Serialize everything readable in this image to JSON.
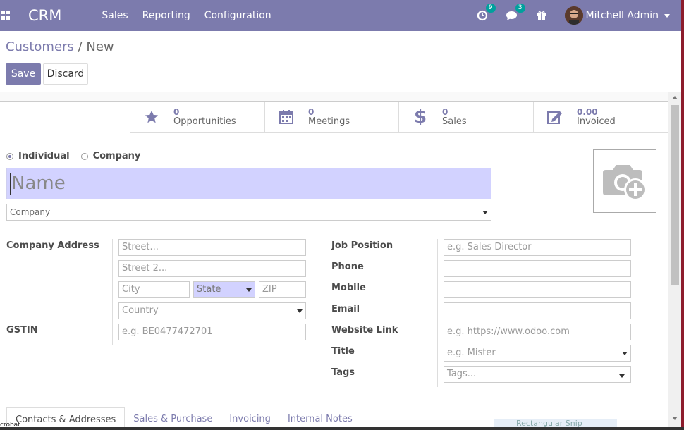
{
  "navbar": {
    "brand": "CRM",
    "menu": [
      "Sales",
      "Reporting",
      "Configuration"
    ],
    "activity_count": "9",
    "messages_count": "3",
    "user_name": "Mitchell Admin",
    "bg_color": "#7c7bad"
  },
  "breadcrumb": {
    "parent": "Customers",
    "separator": "/",
    "current": "New"
  },
  "buttons": {
    "save": "Save",
    "discard": "Discard"
  },
  "stats": [
    {
      "value": "0",
      "label": "Opportunities",
      "icon": "star-icon"
    },
    {
      "value": "0",
      "label": "Meetings",
      "icon": "calendar-icon"
    },
    {
      "value": "0",
      "label": "Sales",
      "icon": "dollar-icon"
    },
    {
      "value": "0.00",
      "label": "Invoiced",
      "icon": "edit-icon"
    }
  ],
  "company_type": {
    "options": [
      "Individual",
      "Company"
    ],
    "selected": "Individual"
  },
  "name_placeholder": "Name",
  "company_placeholder": "Company",
  "address": {
    "label": "Company Address",
    "street": "Street...",
    "street2": "Street 2...",
    "city": "City",
    "state": "State",
    "zip": "ZIP",
    "country": "Country"
  },
  "gstin": {
    "label": "GSTIN",
    "placeholder": "e.g. BE0477472701"
  },
  "right_fields": {
    "job_position": {
      "label": "Job Position",
      "placeholder": "e.g. Sales Director"
    },
    "phone": {
      "label": "Phone",
      "placeholder": ""
    },
    "mobile": {
      "label": "Mobile",
      "placeholder": ""
    },
    "email": {
      "label": "Email",
      "placeholder": ""
    },
    "website": {
      "label": "Website Link",
      "placeholder": "e.g. https://www.odoo.com"
    },
    "title": {
      "label": "Title",
      "placeholder": "e.g. Mister"
    },
    "tags": {
      "label": "Tags",
      "placeholder": "Tags..."
    }
  },
  "tabs": [
    "Contacts & Addresses",
    "Sales & Purchase",
    "Invoicing",
    "Internal Notes"
  ],
  "active_tab": "Contacts & Addresses",
  "overlay_text": "Rectangular Snip",
  "corner_text": "crobat"
}
